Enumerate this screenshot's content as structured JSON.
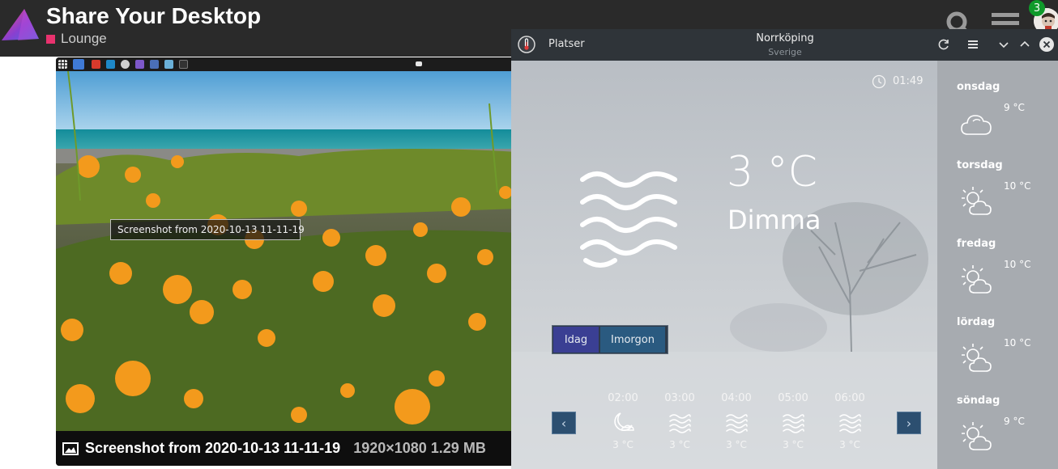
{
  "forum": {
    "topic_title": "Share Your Desktop",
    "category_label": "Lounge",
    "category_color": "#e8326e",
    "notification_count": "3",
    "icons": [
      "app-logo-icon",
      "search-icon",
      "hamburger-menu-icon",
      "avatar"
    ]
  },
  "lightbox": {
    "tooltip": "Screenshot from 2020-10-13 11-11-19",
    "title": "Screenshot from 2020-10-13 11-11-19",
    "meta": "1920×1080 1.29 MB"
  },
  "weather": {
    "places_label": "Platser",
    "city": "Norrköping",
    "country": "Sverige",
    "clock": "01:49",
    "current_temp": "3 °C",
    "current_condition": "Dimma",
    "tab_today": "Idag",
    "tab_tomorrow": "Imorgon",
    "prev_label": "‹",
    "next_label": "›",
    "hourly": [
      {
        "time": "02:00",
        "temp": "3 °C",
        "icon": "moon-icon"
      },
      {
        "time": "03:00",
        "temp": "3 °C",
        "icon": "fog-icon"
      },
      {
        "time": "04:00",
        "temp": "3 °C",
        "icon": "fog-icon"
      },
      {
        "time": "05:00",
        "temp": "3 °C",
        "icon": "fog-icon"
      },
      {
        "time": "06:00",
        "temp": "3 °C",
        "icon": "fog-icon"
      }
    ],
    "daily": [
      {
        "day": "onsdag",
        "temp": "9 °C",
        "icon": "cloudy-icon"
      },
      {
        "day": "torsdag",
        "temp": "10 °C",
        "icon": "partly-cloudy-icon"
      },
      {
        "day": "fredag",
        "temp": "10 °C",
        "icon": "partly-cloudy-icon"
      },
      {
        "day": "lördag",
        "temp": "10 °C",
        "icon": "partly-cloudy-icon"
      },
      {
        "day": "söndag",
        "temp": "9 °C",
        "icon": "partly-cloudy-icon"
      }
    ],
    "colors": {
      "titlebar": "#2f3439",
      "tab_active": "#3a3f93",
      "tab_inactive": "#2a5a80",
      "nav_button": "#2c4f70"
    }
  }
}
